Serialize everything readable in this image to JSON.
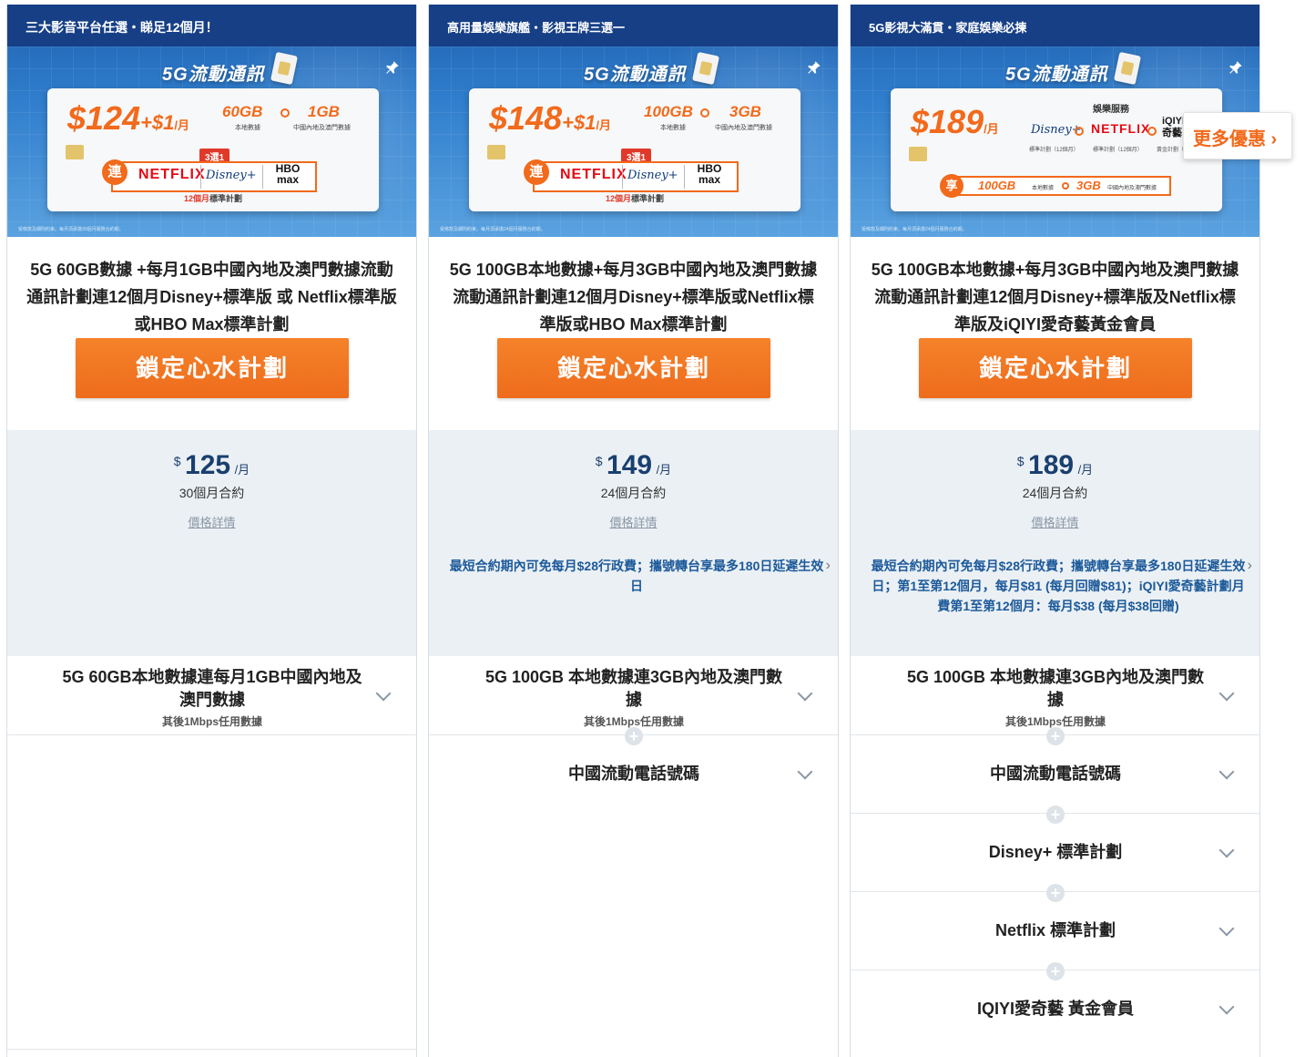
{
  "colors": {
    "accent": "#f26a1b",
    "brand_blue": "#163f86",
    "price_blue": "#1a3f6f",
    "promo_blue": "#1d5a9a"
  },
  "more_offers_label": "更多優惠",
  "more_offers_icon": "chevron-right-icon",
  "cards": [
    {
      "tagline": "三大影音平台任選・睇足12個月！",
      "banner": {
        "title": "5G流動通訊",
        "price_main": "$124",
        "price_plus": "+$1",
        "price_per": "/月",
        "data1": "60GB",
        "data1_sub": "本地數據",
        "data2": "1GB",
        "data2_sub": "中國內地及澳門數據",
        "pick": "3選1",
        "lian": "連",
        "logos": [
          "NETFLIX",
          "Disney+",
          "HBO max"
        ],
        "plan_note_a": "12個月",
        "plan_note_b": "標準計劃",
        "small_print": "受條款及細則約束。每月須承擔30個月服務合約期。"
      },
      "title": "5G 60GB數據 +每月1GB中國內地及澳門數據流動通訊計劃連12個月Disney+標準版 或 Netflix標準版 或HBO Max標準計劃",
      "cta": "鎖定心水計劃",
      "price": {
        "currency": "$",
        "amount": "125",
        "per": "/月",
        "contract": "30個月合約",
        "detail_link": "價格詳情"
      },
      "promo": "",
      "features": [
        {
          "title": "5G 60GB本地數據連每月1GB中國內地及澳門數據",
          "sub": "其後1Mbps任用數據"
        }
      ]
    },
    {
      "tagline": "高用量娛樂旗艦・影視王牌三選一",
      "banner": {
        "title": "5G流動通訊",
        "price_main": "$148",
        "price_plus": "+$1",
        "price_per": "/月",
        "data1": "100GB",
        "data1_sub": "本地數據",
        "data2": "3GB",
        "data2_sub": "中國內地及澳門數據",
        "pick": "3選1",
        "lian": "連",
        "logos": [
          "NETFLIX",
          "Disney+",
          "HBO max"
        ],
        "plan_note_a": "12個月",
        "plan_note_b": "標準計劃",
        "small_print": "受條款及細則約束。每月須承擔24個月服務合約期。"
      },
      "title": "5G 100GB本地數據+每月3GB中國內地及澳門數據 流動通訊計劃連12個月Disney+標準版或Netflix標準版或HBO Max標準計劃",
      "cta": "鎖定心水計劃",
      "price": {
        "currency": "$",
        "amount": "149",
        "per": "/月",
        "contract": "24個月合約",
        "detail_link": "價格詳情"
      },
      "promo": "最短合約期內可免每月$28行政費；攜號轉台享最多180日延遲生效日",
      "features": [
        {
          "title": "5G 100GB 本地數據連3GB內地及澳門數據",
          "sub": "其後1Mbps任用數據"
        },
        {
          "title": "中國流動電話號碼",
          "sub": ""
        }
      ]
    },
    {
      "tagline": "5G影視大滿貫・家庭娛樂必揀",
      "banner": {
        "title": "5G流動通訊",
        "price_main": "$189",
        "price_per": "/月",
        "ent_title": "娛樂服務",
        "logos": [
          "Disney+",
          "NETFLIX",
          "iQIYI 愛奇藝"
        ],
        "logo_subs": [
          "標準計劃（12個月）",
          "標準計劃（12個月）",
          "黃金計劃（12個月）"
        ],
        "xiang": "享",
        "data1": "100GB",
        "data1_sub": "本地數據",
        "data2": "3GB",
        "data2_sub": "中國內地及澳門數據",
        "small_print": "受條款及細則約束。每月須承擔24個月服務合約期。"
      },
      "title": "5G 100GB本地數據+每月3GB中國內地及澳門數據 流動通訊計劃連12個月Disney+標準版及Netflix標準版及iQIYI愛奇藝黃金會員",
      "cta": "鎖定心水計劃",
      "price": {
        "currency": "$",
        "amount": "189",
        "per": "/月",
        "contract": "24個月合約",
        "detail_link": "價格詳情"
      },
      "promo": "最短合約期內可免每月$28行政費；攜號轉台享最多180日延遲生效日；第1至第12個月，每月$81 (每月回贈$81)；iQIYI愛奇藝計劃月費第1至第12個月：每月$38 (每月$38回贈)",
      "features": [
        {
          "title": "5G 100GB 本地數據連3GB內地及澳門數據",
          "sub": "其後1Mbps任用數據"
        },
        {
          "title": "中國流動電話號碼",
          "sub": ""
        },
        {
          "title": "Disney+ 標準計劃",
          "sub": ""
        },
        {
          "title": "Netflix 標準計劃",
          "sub": ""
        },
        {
          "title": "IQIYI愛奇藝 黃金會員",
          "sub": ""
        }
      ]
    }
  ]
}
